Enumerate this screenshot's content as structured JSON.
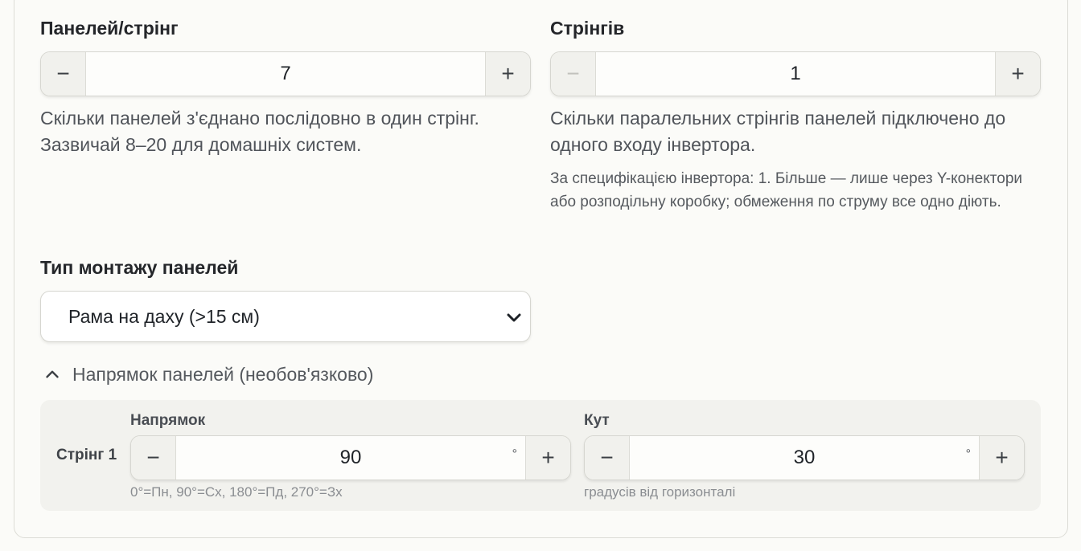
{
  "panels_per_string": {
    "label": "Панелей/стрінг",
    "value": "7",
    "minus": "−",
    "plus": "+",
    "help": "Скільки панелей з'єднано послідовно в один стрінг. Зазвичай 8–20 для домашніх систем."
  },
  "strings": {
    "label": "Стрінгів",
    "value": "1",
    "minus": "−",
    "plus": "+",
    "help": "Скільки паралельних стрінгів панелей підключено до одного входу інвертора.",
    "note": "За специфікацією інвертора: 1. Більше — лише через Y-конектори або розподільну коробку; обмеження по струму все одно діють."
  },
  "mounting": {
    "label": "Тип монтажу панелей",
    "selected": "Рама на даху (>15 см)"
  },
  "orientation": {
    "toggle_label": "Напрямок панелей (необов'язково)",
    "expanded": true,
    "string_label": "Стрінг 1",
    "direction": {
      "label": "Напрямок",
      "value": "90",
      "unit": "°",
      "minus": "−",
      "plus": "+",
      "hint": "0°=Пн, 90°=Сх, 180°=Пд, 270°=Зх"
    },
    "angle": {
      "label": "Кут",
      "value": "30",
      "unit": "°",
      "minus": "−",
      "plus": "+",
      "hint": "градусів від горизонталі"
    }
  }
}
